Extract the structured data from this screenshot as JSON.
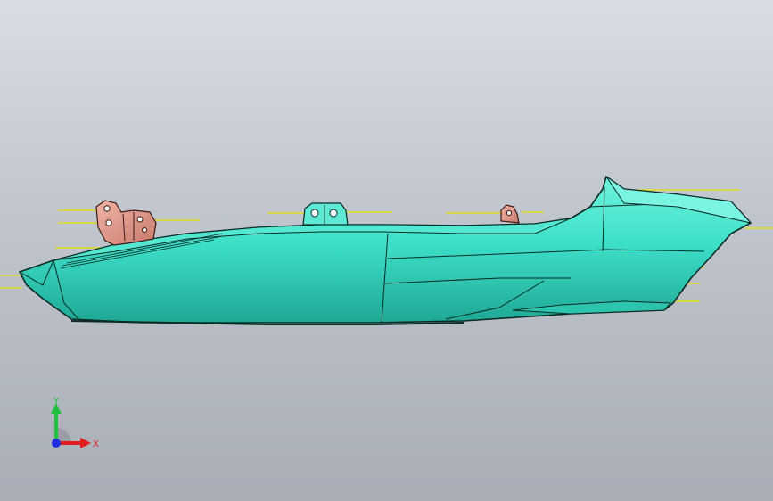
{
  "viewport": {
    "background_top": "#d9dde3",
    "background_bottom": "#a8adb6"
  },
  "model": {
    "body_color": "#3ee0c8",
    "body_shadow": "#1fa593",
    "edge_color": "#0b2a25",
    "bracket_color": "#e39a8c",
    "mount_color": "#3ee0c8",
    "dimension_line_color": "#e8e000"
  },
  "triad": {
    "x_label": "X",
    "y_label": "Y",
    "x_color": "#e02020",
    "y_color": "#20c040",
    "z_color": "#2030e0"
  }
}
